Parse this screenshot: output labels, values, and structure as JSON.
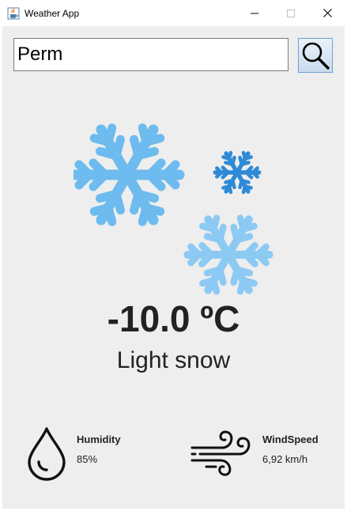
{
  "window": {
    "title": "Weather App",
    "icon": "java-cup-icon"
  },
  "search": {
    "value": "Perm",
    "button_icon": "magnifier-icon"
  },
  "weather": {
    "icon": "snow-icon",
    "temperature": "-10.0 ºC",
    "condition": "Light snow"
  },
  "humidity": {
    "icon": "water-drop-icon",
    "label": "Humidity",
    "value": "85%"
  },
  "wind": {
    "icon": "wind-icon",
    "label": "WindSpeed",
    "value": "6,92 km/h"
  },
  "colors": {
    "snow_primary": "#6dbbef",
    "snow_dark": "#2e8ad6",
    "snow_light": "#8dcaf3",
    "background": "#eeeeee"
  }
}
